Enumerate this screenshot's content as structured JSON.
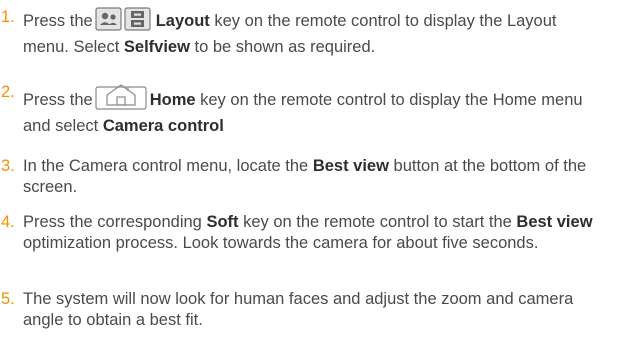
{
  "accent_color": "#f39200",
  "steps": [
    {
      "number": "1.",
      "p1": "Press the",
      "key_icon": "layout-key-icon",
      "b1": "Layout",
      "p2": " key on the remote control to display the Layout menu. Select ",
      "b2": "Selfview",
      "p3": " to be shown as required."
    },
    {
      "number": "2.",
      "p1": "Press the",
      "key_icon": "home-key-icon",
      "b1": "Home",
      "p2": " key on the remote control to display the Home menu and select ",
      "b2": "Camera control"
    },
    {
      "number": "3.",
      "p1": "In the Camera control menu, locate the ",
      "b1": "Best view",
      "p2": " button at the bottom of the screen."
    },
    {
      "number": "4.",
      "p1": "Press the corresponding ",
      "b1": "Soft",
      "p2": " key on the remote control to start the ",
      "b2": "Best view",
      "p3": " optimization process. Look towards the camera for about five seconds."
    },
    {
      "number": "5.",
      "p1": "The system will now look for human faces and adjust the zoom and camera angle to obtain a best fit."
    }
  ]
}
